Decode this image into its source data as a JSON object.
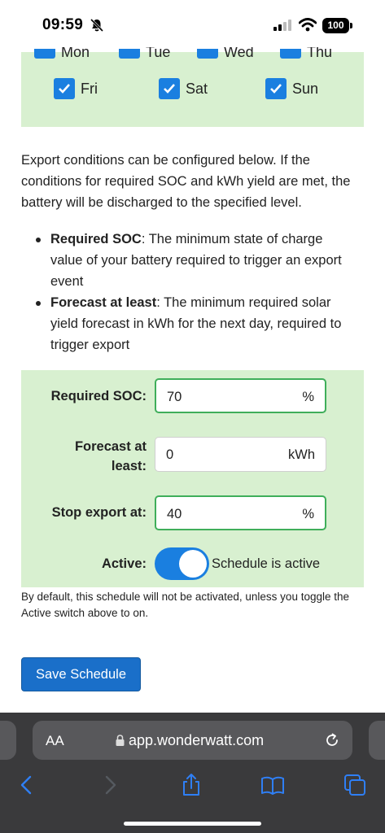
{
  "status_bar": {
    "time": "09:59",
    "battery": "100"
  },
  "days": {
    "row1": [
      {
        "label": "Mon",
        "checked": true
      },
      {
        "label": "Tue",
        "checked": true
      },
      {
        "label": "Wed",
        "checked": true
      },
      {
        "label": "Thu",
        "checked": true
      }
    ],
    "row2": [
      {
        "label": "Fri",
        "checked": true
      },
      {
        "label": "Sat",
        "checked": true
      },
      {
        "label": "Sun",
        "checked": true
      }
    ]
  },
  "intro_text": "Export conditions can be configured below. If the conditions for required SOC and kWh yield are met, the battery will be discharged to the specified level.",
  "bullets": [
    {
      "term": "Required SOC",
      "text": ": The minimum state of charge value of your battery required to trigger an export event"
    },
    {
      "term": "Forecast at least",
      "text": ": The minimum required solar yield forecast in kWh for the next day, required to trigger export"
    }
  ],
  "form": {
    "required_soc": {
      "label": "Required SOC:",
      "value": "70",
      "unit": "%"
    },
    "forecast": {
      "label_line1": "Forecast at",
      "label_line2": "least:",
      "value": "0",
      "unit": "kWh"
    },
    "stop_export": {
      "label": "Stop export at:",
      "value": "40",
      "unit": "%"
    },
    "active": {
      "label": "Active:",
      "on": true,
      "status_text": "Schedule is active"
    }
  },
  "note": "By default, this schedule will not be activated, unless you toggle the Active switch above to on.",
  "save_button": "Save Schedule",
  "browser": {
    "aa_label": "AA",
    "url": "app.wonderwatt.com"
  },
  "colors": {
    "accent": "#1a7fe0",
    "panel_bg": "#d8f0d0",
    "focus_border": "#3fae5a",
    "button": "#1a6fc9"
  }
}
